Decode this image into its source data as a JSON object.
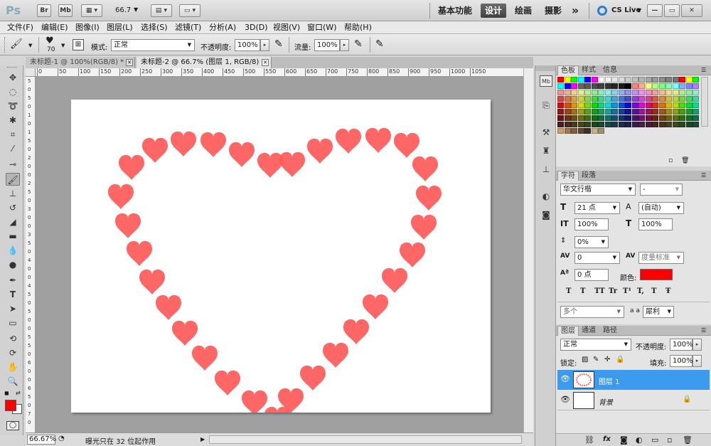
{
  "appbar": {
    "ps_logo": "Ps",
    "br_label": "Br",
    "mb_label": "Mb",
    "zoom": "66.7",
    "workspaces": [
      "基本功能",
      "设计",
      "绘画",
      "摄影"
    ],
    "more": "»",
    "cslive": "CS Live"
  },
  "menu": [
    "文件(F)",
    "编辑(E)",
    "图像(I)",
    "图层(L)",
    "选择(S)",
    "滤镜(T)",
    "分析(A)",
    "3D(D)",
    "视图(V)",
    "窗口(W)",
    "帮助(H)"
  ],
  "options": {
    "brush_size": "70",
    "mode_label": "模式:",
    "mode_value": "正常",
    "opacity_label": "不透明度:",
    "opacity_value": "100%",
    "flow_label": "流量:",
    "flow_value": "100%"
  },
  "doc_tabs": [
    "未标题-1 @ 100%(RGB/8) *",
    "未标题-2 @ 66.7% (图层 1, RGB/8) *"
  ],
  "ruler_top": [
    "0",
    "50",
    "100",
    "150",
    "200",
    "250",
    "300",
    "350",
    "400",
    "450",
    "500",
    "550",
    "600",
    "650",
    "700",
    "750",
    "800",
    "850",
    "900",
    "950",
    "1000",
    "1050"
  ],
  "ruler_left": [
    "5",
    "0",
    "5",
    "0",
    "1",
    "0",
    "1",
    "5",
    "0",
    "2",
    "0",
    "0",
    "2",
    "5",
    "0",
    "3",
    "0",
    "0",
    "3",
    "5",
    "0",
    "4",
    "0",
    "0",
    "4",
    "5",
    "0",
    "5",
    "0",
    "0",
    "5",
    "5",
    "0",
    "6",
    "0",
    "0",
    "6",
    "5",
    "0",
    "7",
    "0"
  ],
  "status": {
    "zoom": "66.67%",
    "info": "曝光只在 32 位起作用"
  },
  "colors": {
    "heart": "#ff5a5a",
    "foreground": "#ff0000",
    "layer_selected": "#3d9bef"
  },
  "swatch_panel": {
    "tabs": [
      "色板",
      "样式",
      "信息"
    ]
  },
  "char_panel": {
    "tabs": [
      "字符",
      "段落"
    ],
    "font_family": "华文行楷",
    "font_style": "-",
    "size": "21 点",
    "leading": "(自动)",
    "vscale": "100%",
    "hscale": "100%",
    "tsume": "0%",
    "kerning": "0",
    "tracking": "度量标准",
    "baseline": "0 点",
    "color_label": "颜色:",
    "style_buttons": [
      "T",
      "T",
      "TT",
      "Tr",
      "T¹",
      "T,",
      "T",
      "Ŧ"
    ],
    "language": "多个",
    "aa_label": "a a",
    "aa_value": "犀利"
  },
  "layers_panel": {
    "tabs": [
      "图层",
      "通道",
      "路径"
    ],
    "blend": "正常",
    "opacity_label": "不透明度:",
    "opacity_value": "100%",
    "lock_label": "锁定:",
    "fill_label": "填充:",
    "fill_value": "100%",
    "layers": [
      {
        "name": "图层 1",
        "selected": true
      },
      {
        "name": "背景",
        "selected": false
      }
    ]
  }
}
